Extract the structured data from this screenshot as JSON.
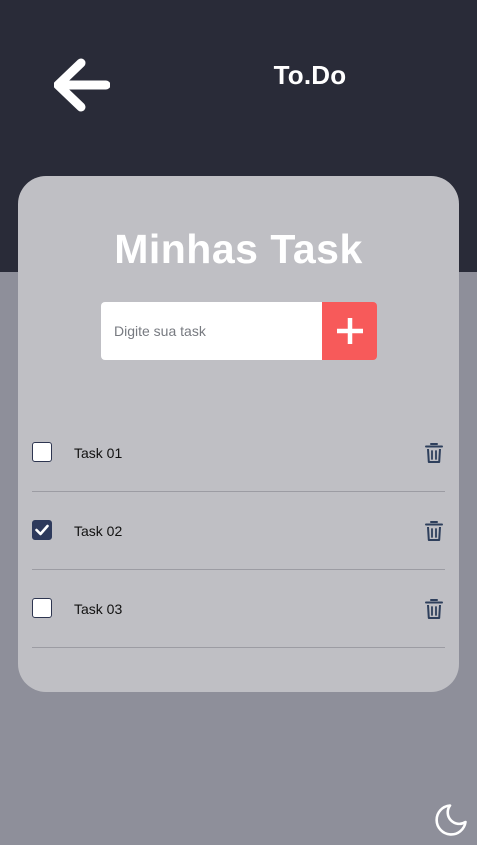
{
  "header": {
    "back_icon": "arrow-left-icon",
    "app_title": "To.Do",
    "bg_color": "#292b38"
  },
  "card": {
    "title": "Minhas Task",
    "input": {
      "placeholder": "Digite sua task",
      "value": ""
    },
    "add_button_icon": "plus-icon",
    "add_button_color": "#f75a5a"
  },
  "tasks": [
    {
      "label": "Task 01",
      "checked": false
    },
    {
      "label": "Task 02",
      "checked": true
    },
    {
      "label": "Task 03",
      "checked": false
    }
  ],
  "footer": {
    "theme_toggle_icon": "moon-icon"
  }
}
